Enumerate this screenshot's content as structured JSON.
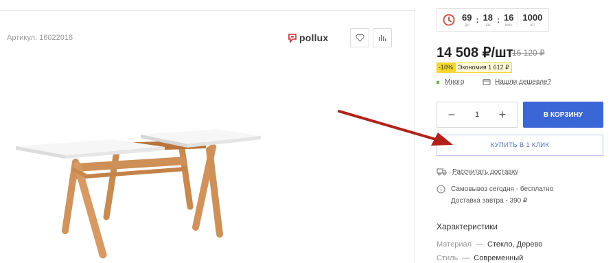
{
  "product": {
    "sku_label": "Артикул: 16022018",
    "brand": "pollux"
  },
  "timer": {
    "days": "69",
    "days_unit": "дн",
    "hours": "18",
    "hours_unit": "час",
    "minutes": "16",
    "minutes_unit": "мин",
    "stock": "1000",
    "stock_unit": "шт",
    "sep": ":"
  },
  "price": {
    "current": "14 508 ₽/шт",
    "old": "16 120 ₽",
    "discount": "-10%",
    "saving": "Экономия 1 612 ₽"
  },
  "availability": {
    "stock": "Много",
    "cheaper_link": "Нашли дешевле?"
  },
  "purchase": {
    "quantity": "1",
    "minus": "−",
    "plus": "+",
    "cart_label": "В КОРЗИНУ",
    "oneclick_label": "КУПИТЬ В 1 КЛИК"
  },
  "delivery": {
    "calc_link": "Рассчитать доставку",
    "pickup": "Самовывоз сегодня - бесплатно",
    "courier": "Доставка завтра - 390 ₽"
  },
  "specs": {
    "title": "Характеристики",
    "dash": "—",
    "items": [
      {
        "key": "Материал",
        "value": "Стекло, Дерево"
      },
      {
        "key": "Стиль",
        "value": "Современный"
      }
    ]
  },
  "colors": {
    "accent": "#3a66d6",
    "badge": "#f3d52b",
    "stock_dot": "#5ab436",
    "arrow": "#b2211a",
    "timer_icon": "#e0403a"
  },
  "icons": [
    "pollux-logo-icon",
    "heart-icon",
    "compare-icon",
    "clock-icon",
    "tag-icon",
    "truck-icon",
    "info-icon",
    "arrow-annotation-icon"
  ]
}
